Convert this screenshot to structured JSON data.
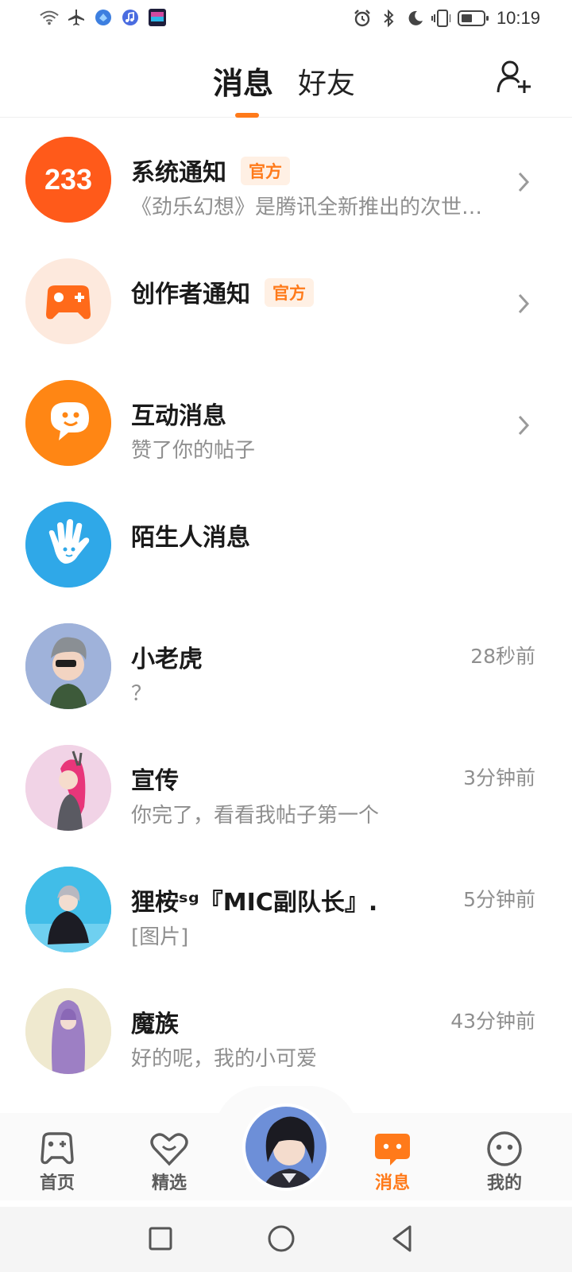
{
  "status_bar": {
    "time": "10:19",
    "left_icons": [
      "wifi-icon",
      "airplane-icon",
      "app-notification-icon",
      "music-icon",
      "gallery-icon"
    ],
    "right_icons": [
      "alarm-icon",
      "bluetooth-icon",
      "moon-icon",
      "vibrate-icon",
      "battery-icon"
    ]
  },
  "header": {
    "tabs": [
      {
        "label": "消息",
        "active": true
      },
      {
        "label": "好友",
        "active": false
      }
    ],
    "add_friend_icon": "add-friend-icon",
    "accent_color": "#ff7a1a"
  },
  "messages": [
    {
      "title": "系统通知",
      "badge": "官方",
      "preview": "《劲乐幻想》是腾讯全新推出的次世…",
      "has_chevron": true,
      "avatar": "233-logo",
      "avatar_color": "#ff5a1a"
    },
    {
      "title": "创作者通知",
      "badge": "官方",
      "preview": "",
      "has_chevron": true,
      "avatar": "gamepad-icon",
      "avatar_color": "#fde9dd"
    },
    {
      "title": "互动消息",
      "preview": "赞了你的帖子",
      "has_chevron": true,
      "avatar": "chat-bubble-icon",
      "avatar_color": "#ff8a14"
    },
    {
      "title": "陌生人消息",
      "preview": "",
      "has_chevron": false,
      "avatar": "hand-icon",
      "avatar_color": "#2fa8e8"
    },
    {
      "title": "小老虎",
      "preview": "？",
      "time": "28秒前",
      "avatar": "user-avatar"
    },
    {
      "title": "宣传",
      "preview": "你完了，看看我帖子第一个",
      "time": "3分钟前",
      "avatar": "user-avatar"
    },
    {
      "title": "狸桉ˢᵍ『MIC副队长』.",
      "preview": "[图片]",
      "time": "5分钟前",
      "avatar": "user-avatar"
    },
    {
      "title": "魔族",
      "preview": "好的呢，我的小可爱",
      "time": "43分钟前",
      "avatar": "user-avatar"
    }
  ],
  "bottom_nav": [
    {
      "label": "首页",
      "icon": "gamepad-icon",
      "active": false
    },
    {
      "label": "精选",
      "icon": "heart-icon",
      "active": false
    },
    {
      "label": "消息",
      "icon": "message-icon",
      "active": true
    },
    {
      "label": "我的",
      "icon": "face-icon",
      "active": false
    }
  ],
  "system_nav": [
    "recent-apps-icon",
    "home-icon",
    "back-icon"
  ]
}
